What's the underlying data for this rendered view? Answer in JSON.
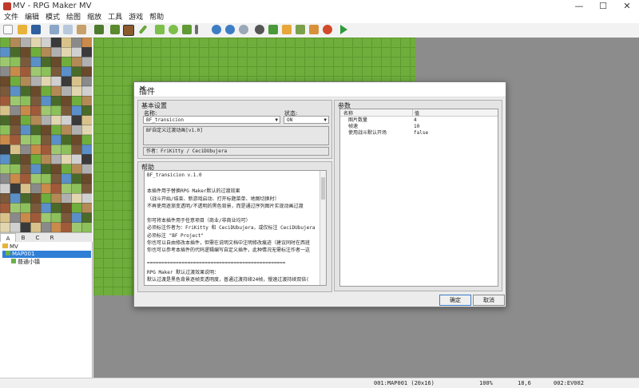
{
  "window": {
    "title": "MV - RPG Maker MV",
    "minimize": "—",
    "maximize": "☐",
    "close": "✕"
  },
  "menu": [
    "文件",
    "编辑",
    "模式",
    "绘图",
    "缩放",
    "工具",
    "游戏",
    "帮助"
  ],
  "tileset_tabs": [
    "A",
    "B",
    "C",
    "R"
  ],
  "tree": {
    "project": "MV",
    "map": "MAP001",
    "event": "普通小镇"
  },
  "status": {
    "map": "001:MAP001 (20x16)",
    "zoom": "100%",
    "coords": "18,6",
    "event": "002:EV002"
  },
  "dialog": {
    "title": "插件",
    "close": "✕",
    "basic": {
      "section": "基本设置",
      "name_label": "名称:",
      "name_value": "BF_transicion",
      "status_label": "状态:",
      "status_value": "ON",
      "description": "BF自定义过渡动画[v1.0]",
      "author": "作者：FriKitty / CeciDUbujera"
    },
    "help": {
      "section": "帮助",
      "lines": [
        "BF_transicion v.1.0",
        "",
        "本插件用于替换RPG Maker默认的过渡效果",
        "（战斗开始/结束、新游戏启动、打开标题菜单、地图切换时）",
        "不再使用逐渐变透明/不透明的黑色背景，而是通过序列图片实现动画过渡",
        "",
        "你可将本插件用于任意项目（商业/非商业均可）",
        "必须标注作者为：FriKitty 和 CeciDUbujera，或仅标注 CeciDUbujera",
        "必须标注 \"BF Project\"",
        "你也可以自由修改本插件，但需在说明文档中注明修改痕迹（建议同时在西班",
        "你也可以参考本插件的代码逻辑编写自定义插件，此种情况无需标注作者一这",
        "",
        "================================================",
        "RPG Maker 默认过渡效果说明：",
        "默认过渡是黑色背景逐帧变透明度，普通过渡持续24帧，慢速过渡持续双倍("
      ]
    },
    "params": {
      "section": "参数",
      "col_name": "名称",
      "col_value": "值",
      "rows": [
        {
          "name": "图片数量",
          "value": "4"
        },
        {
          "name": "帧速",
          "value": "10"
        },
        {
          "name": "使用战斗默认开场",
          "value": "false"
        }
      ]
    },
    "ok": "确定",
    "cancel": "取消"
  }
}
